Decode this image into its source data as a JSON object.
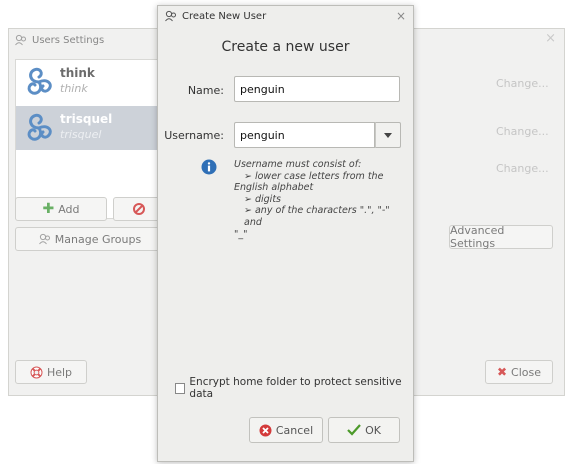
{
  "background_window": {
    "title": "Users Settings",
    "users": [
      {
        "name": "think",
        "subtitle": "think"
      },
      {
        "name": "trisquel",
        "subtitle": "trisquel"
      }
    ],
    "add_label": "Add",
    "manage_groups_label": "Manage Groups",
    "change_labels": [
      "Change...",
      "Change...",
      "Change..."
    ],
    "advanced_label": "Advanced Settings",
    "help_label": "Help",
    "close_label": "Close"
  },
  "dialog": {
    "title": "Create New User",
    "heading": "Create a new user",
    "name_label": "Name:",
    "name_value": "penguin",
    "username_label": "Username:",
    "username_value": "penguin",
    "info_lines": [
      "Username must consist of:",
      "➢ lower case letters from the",
      "English alphabet",
      "➢ digits",
      "➢ any of the characters \".\", \"-\" and",
      "\"_\""
    ],
    "encrypt_label": "Encrypt home folder to protect sensitive data",
    "encrypt_checked": false,
    "cancel_label": "Cancel",
    "ok_label": "OK"
  },
  "colors": {
    "selected_row": "#bfc6cf",
    "triskelion": "#2f6fb6",
    "info_icon": "#2f6fb6"
  }
}
